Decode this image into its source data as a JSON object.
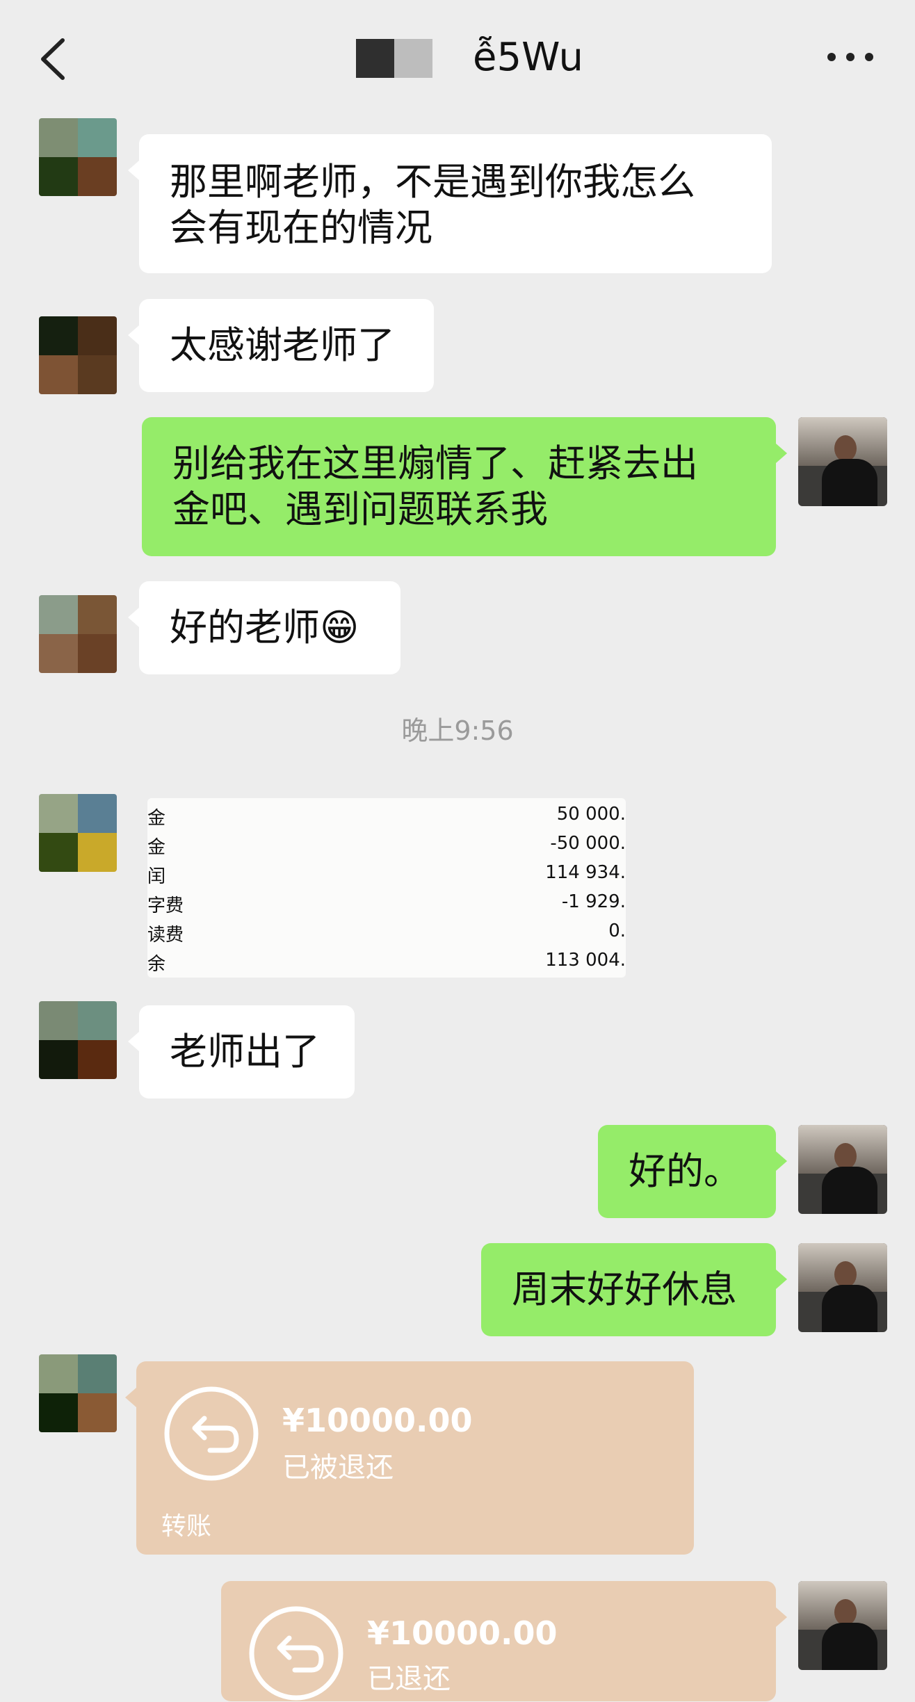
{
  "header": {
    "title": "ễ5Wu",
    "icons": {
      "back": "chevron-left-icon",
      "more": "more-dots-icon"
    }
  },
  "messages": {
    "m1": "那里啊老师，不是遇到你我怎么\n会有现在的情况",
    "m2": "太感谢老师了",
    "m3": "别给我在这里煽情了、赶紧去出\n金吧、遇到问题联系我",
    "m4": "好的老师😁",
    "m5": "老师出了",
    "m6": "好的。",
    "m7": "周末好好休息"
  },
  "time_divider": "晚上9:56",
  "image_message": {
    "rows": [
      {
        "label": "金",
        "value": "50 000."
      },
      {
        "label": "金",
        "value": "-50 000."
      },
      {
        "label": "闰",
        "value": "114 934."
      },
      {
        "label": "字费",
        "value": "-1 929."
      },
      {
        "label": "读费",
        "value": "0."
      },
      {
        "label": "余",
        "value": "113 004."
      }
    ]
  },
  "transfer_in": {
    "amount": "¥10000.00",
    "status": "已被退还",
    "label": "转账"
  },
  "transfer_out": {
    "amount": "¥10000.00",
    "status": "已退还"
  },
  "colors": {
    "background": "#ededed",
    "incoming_bubble": "#ffffff",
    "outgoing_bubble": "#95ec69",
    "transfer_card": "#e9cdb3"
  }
}
